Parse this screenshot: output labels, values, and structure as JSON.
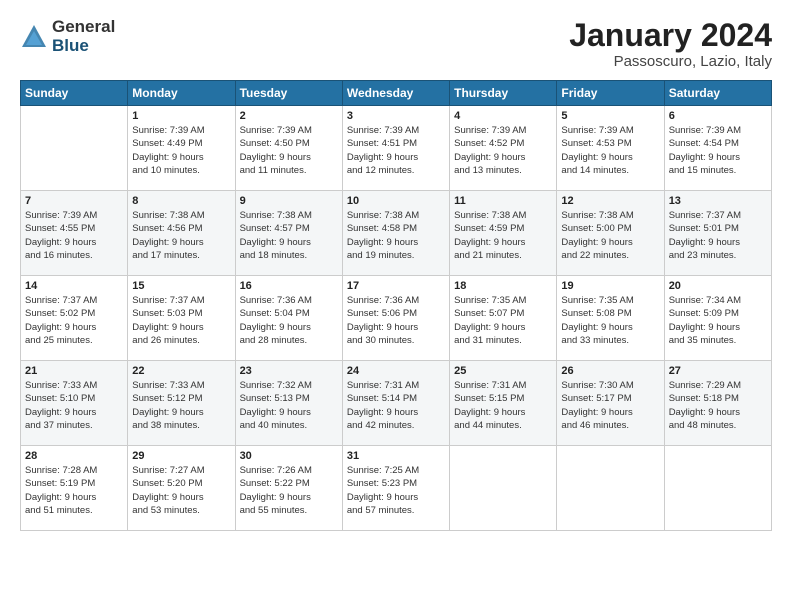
{
  "header": {
    "logo_general": "General",
    "logo_blue": "Blue",
    "title": "January 2024",
    "subtitle": "Passoscuro, Lazio, Italy"
  },
  "days_of_week": [
    "Sunday",
    "Monday",
    "Tuesday",
    "Wednesday",
    "Thursday",
    "Friday",
    "Saturday"
  ],
  "weeks": [
    [
      {
        "day": "",
        "lines": []
      },
      {
        "day": "1",
        "lines": [
          "Sunrise: 7:39 AM",
          "Sunset: 4:49 PM",
          "Daylight: 9 hours",
          "and 10 minutes."
        ]
      },
      {
        "day": "2",
        "lines": [
          "Sunrise: 7:39 AM",
          "Sunset: 4:50 PM",
          "Daylight: 9 hours",
          "and 11 minutes."
        ]
      },
      {
        "day": "3",
        "lines": [
          "Sunrise: 7:39 AM",
          "Sunset: 4:51 PM",
          "Daylight: 9 hours",
          "and 12 minutes."
        ]
      },
      {
        "day": "4",
        "lines": [
          "Sunrise: 7:39 AM",
          "Sunset: 4:52 PM",
          "Daylight: 9 hours",
          "and 13 minutes."
        ]
      },
      {
        "day": "5",
        "lines": [
          "Sunrise: 7:39 AM",
          "Sunset: 4:53 PM",
          "Daylight: 9 hours",
          "and 14 minutes."
        ]
      },
      {
        "day": "6",
        "lines": [
          "Sunrise: 7:39 AM",
          "Sunset: 4:54 PM",
          "Daylight: 9 hours",
          "and 15 minutes."
        ]
      }
    ],
    [
      {
        "day": "7",
        "lines": [
          "Sunrise: 7:39 AM",
          "Sunset: 4:55 PM",
          "Daylight: 9 hours",
          "and 16 minutes."
        ]
      },
      {
        "day": "8",
        "lines": [
          "Sunrise: 7:38 AM",
          "Sunset: 4:56 PM",
          "Daylight: 9 hours",
          "and 17 minutes."
        ]
      },
      {
        "day": "9",
        "lines": [
          "Sunrise: 7:38 AM",
          "Sunset: 4:57 PM",
          "Daylight: 9 hours",
          "and 18 minutes."
        ]
      },
      {
        "day": "10",
        "lines": [
          "Sunrise: 7:38 AM",
          "Sunset: 4:58 PM",
          "Daylight: 9 hours",
          "and 19 minutes."
        ]
      },
      {
        "day": "11",
        "lines": [
          "Sunrise: 7:38 AM",
          "Sunset: 4:59 PM",
          "Daylight: 9 hours",
          "and 21 minutes."
        ]
      },
      {
        "day": "12",
        "lines": [
          "Sunrise: 7:38 AM",
          "Sunset: 5:00 PM",
          "Daylight: 9 hours",
          "and 22 minutes."
        ]
      },
      {
        "day": "13",
        "lines": [
          "Sunrise: 7:37 AM",
          "Sunset: 5:01 PM",
          "Daylight: 9 hours",
          "and 23 minutes."
        ]
      }
    ],
    [
      {
        "day": "14",
        "lines": [
          "Sunrise: 7:37 AM",
          "Sunset: 5:02 PM",
          "Daylight: 9 hours",
          "and 25 minutes."
        ]
      },
      {
        "day": "15",
        "lines": [
          "Sunrise: 7:37 AM",
          "Sunset: 5:03 PM",
          "Daylight: 9 hours",
          "and 26 minutes."
        ]
      },
      {
        "day": "16",
        "lines": [
          "Sunrise: 7:36 AM",
          "Sunset: 5:04 PM",
          "Daylight: 9 hours",
          "and 28 minutes."
        ]
      },
      {
        "day": "17",
        "lines": [
          "Sunrise: 7:36 AM",
          "Sunset: 5:06 PM",
          "Daylight: 9 hours",
          "and 30 minutes."
        ]
      },
      {
        "day": "18",
        "lines": [
          "Sunrise: 7:35 AM",
          "Sunset: 5:07 PM",
          "Daylight: 9 hours",
          "and 31 minutes."
        ]
      },
      {
        "day": "19",
        "lines": [
          "Sunrise: 7:35 AM",
          "Sunset: 5:08 PM",
          "Daylight: 9 hours",
          "and 33 minutes."
        ]
      },
      {
        "day": "20",
        "lines": [
          "Sunrise: 7:34 AM",
          "Sunset: 5:09 PM",
          "Daylight: 9 hours",
          "and 35 minutes."
        ]
      }
    ],
    [
      {
        "day": "21",
        "lines": [
          "Sunrise: 7:33 AM",
          "Sunset: 5:10 PM",
          "Daylight: 9 hours",
          "and 37 minutes."
        ]
      },
      {
        "day": "22",
        "lines": [
          "Sunrise: 7:33 AM",
          "Sunset: 5:12 PM",
          "Daylight: 9 hours",
          "and 38 minutes."
        ]
      },
      {
        "day": "23",
        "lines": [
          "Sunrise: 7:32 AM",
          "Sunset: 5:13 PM",
          "Daylight: 9 hours",
          "and 40 minutes."
        ]
      },
      {
        "day": "24",
        "lines": [
          "Sunrise: 7:31 AM",
          "Sunset: 5:14 PM",
          "Daylight: 9 hours",
          "and 42 minutes."
        ]
      },
      {
        "day": "25",
        "lines": [
          "Sunrise: 7:31 AM",
          "Sunset: 5:15 PM",
          "Daylight: 9 hours",
          "and 44 minutes."
        ]
      },
      {
        "day": "26",
        "lines": [
          "Sunrise: 7:30 AM",
          "Sunset: 5:17 PM",
          "Daylight: 9 hours",
          "and 46 minutes."
        ]
      },
      {
        "day": "27",
        "lines": [
          "Sunrise: 7:29 AM",
          "Sunset: 5:18 PM",
          "Daylight: 9 hours",
          "and 48 minutes."
        ]
      }
    ],
    [
      {
        "day": "28",
        "lines": [
          "Sunrise: 7:28 AM",
          "Sunset: 5:19 PM",
          "Daylight: 9 hours",
          "and 51 minutes."
        ]
      },
      {
        "day": "29",
        "lines": [
          "Sunrise: 7:27 AM",
          "Sunset: 5:20 PM",
          "Daylight: 9 hours",
          "and 53 minutes."
        ]
      },
      {
        "day": "30",
        "lines": [
          "Sunrise: 7:26 AM",
          "Sunset: 5:22 PM",
          "Daylight: 9 hours",
          "and 55 minutes."
        ]
      },
      {
        "day": "31",
        "lines": [
          "Sunrise: 7:25 AM",
          "Sunset: 5:23 PM",
          "Daylight: 9 hours",
          "and 57 minutes."
        ]
      },
      {
        "day": "",
        "lines": []
      },
      {
        "day": "",
        "lines": []
      },
      {
        "day": "",
        "lines": []
      }
    ]
  ]
}
